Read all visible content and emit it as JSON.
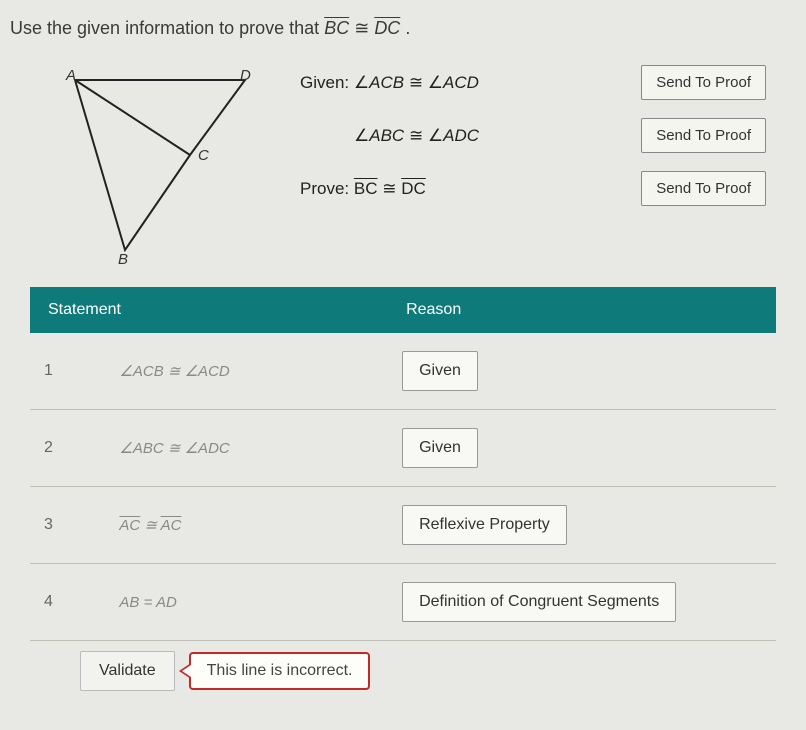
{
  "prompt": {
    "prefix": "Use the given information to prove that ",
    "seg1": "BC",
    "rel": " ≅ ",
    "seg2": "DC",
    "suffix": "."
  },
  "diagram": {
    "labels": {
      "A": "A",
      "B": "B",
      "C": "C",
      "D": "D"
    }
  },
  "given": {
    "given_label": "Given:",
    "line1": {
      "lhs": "ACB",
      "op": "≅",
      "rhs": "ACD"
    },
    "line2": {
      "lhs": "ABC",
      "op": "≅",
      "rhs": "ADC"
    },
    "prove_label": "Prove:",
    "prove": {
      "seg1": "BC",
      "op": "≅",
      "seg2": "DC"
    },
    "send_button": "Send To Proof"
  },
  "table": {
    "headers": {
      "statement": "Statement",
      "reason": "Reason"
    },
    "rows": [
      {
        "num": "1",
        "statement_raw": "∠ACB ≅ ∠ACD",
        "reason": "Given"
      },
      {
        "num": "2",
        "statement_raw": "∠ABC ≅ ∠ADC",
        "reason": "Given"
      },
      {
        "num": "3",
        "statement_seg1": "AC",
        "statement_op": "≅",
        "statement_seg2": "AC",
        "reason": "Reflexive Property"
      },
      {
        "num": "4",
        "statement_plain": "AB = AD",
        "reason": "Definition of Congruent Segments"
      }
    ]
  },
  "validate": {
    "button": "Validate",
    "error": "This line is incorrect."
  }
}
